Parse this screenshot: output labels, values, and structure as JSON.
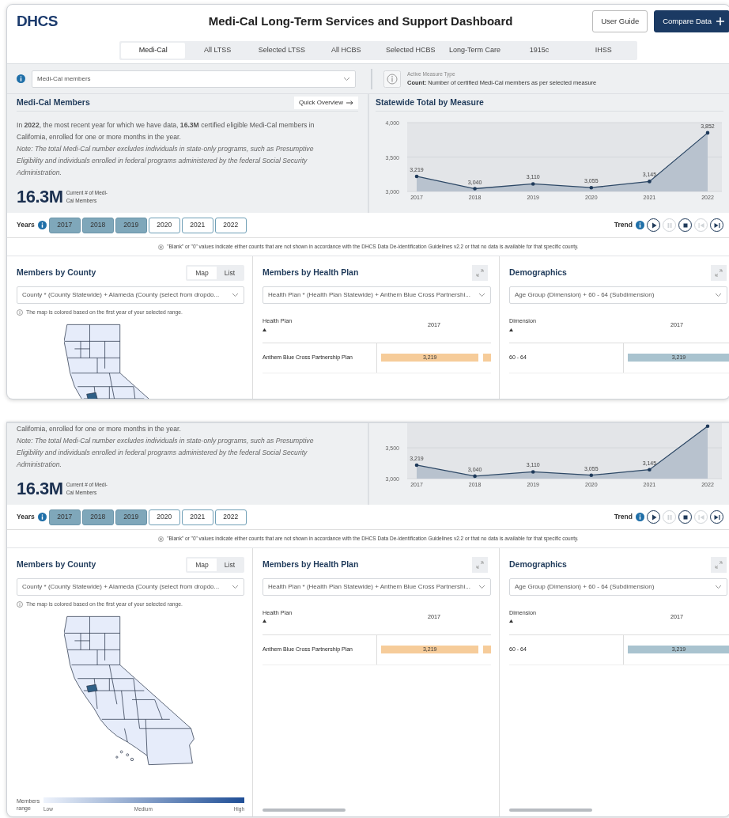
{
  "views": [
    {
      "header": {
        "logo": "DHCS",
        "title": "Medi-Cal Long-Term Services and Support Dashboard",
        "buttons": [
          {
            "label": "User Guide",
            "kind": "outline"
          },
          {
            "label": "Compare Data",
            "kind": "primary"
          }
        ]
      },
      "tabs": [
        {
          "label": "Medi-Cal",
          "selected": true
        },
        {
          "label": "All LTSS",
          "selected": false
        },
        {
          "label": "Selected LTSS",
          "selected": false
        },
        {
          "label": "All HCBS",
          "selected": false
        },
        {
          "label": "Selected HCBS",
          "selected": false
        },
        {
          "label": "Long-Term Care",
          "selected": false
        },
        {
          "label": "1915c",
          "selected": false
        },
        {
          "label": "IHSS",
          "selected": false
        }
      ],
      "measure": {
        "select": "Medi-Cal members",
        "info_label": "Active Measure Type",
        "info_text": "**Count:** Number of certified Medi-Cal members as per selected measure"
      },
      "summary": {
        "title": "Medi-Cal Members",
        "action": "Quick Overview",
        "intro": "In **2022**, the most recent year for which we have data, **16.3M** certified eligible Medi-Cal members in California, enrolled for one or more months in the year.",
        "note": "Note: The total Medi-Cal number excludes individuals in state-only programs, such as Presumptive Eligibility and individuals enrolled in federal programs administered by the federal Social Security Administration.",
        "stat": "16.3M",
        "stat_label": "Current # of Medi-Cal Members"
      },
      "chart": {
        "title": "Statewide Total by Measure",
        "chart_data": {
          "type": "area",
          "categories": [
            "2017",
            "2018",
            "2019",
            "2020",
            "2021",
            "2022"
          ],
          "values": [
            3219,
            3040,
            3110,
            3055,
            3145,
            3852
          ],
          "ylim": [
            3000,
            4000
          ],
          "yticks": [
            {
              "value": 3000,
              "label": "3,000"
            },
            {
              "value": 3500,
              "label": "3,500"
            },
            {
              "value": 4000,
              "label": "4,000"
            }
          ],
          "value_labels": [
            "3,219",
            "3,040",
            "3,110",
            "3,055",
            "3,145",
            "3,852"
          ]
        }
      },
      "years": {
        "label": "Years",
        "items": [
          {
            "label": "2017",
            "selected": true
          },
          {
            "label": "2018",
            "selected": true
          },
          {
            "label": "2019",
            "selected": true
          },
          {
            "label": "2020",
            "selected": false
          },
          {
            "label": "2021",
            "selected": false
          },
          {
            "label": "2022",
            "selected": false
          }
        ]
      },
      "trend": {
        "label": "Trend",
        "controls": [
          {
            "kind": "play",
            "disabled": false
          },
          {
            "kind": "pause",
            "disabled": true
          },
          {
            "kind": "stop",
            "disabled": false
          },
          {
            "kind": "back",
            "disabled": true
          },
          {
            "kind": "end",
            "disabled": false
          }
        ]
      },
      "disclaimer": "\"Blank\" or \"0\" values indicate either counts that are not shown in accordance with the DHCS Data De-identification Guidelines v2.2 or that no data is available for that specific county.",
      "county": {
        "title": "Members by County",
        "toggle": [
          {
            "label": "Map",
            "selected": true
          },
          {
            "label": "List",
            "selected": false
          }
        ],
        "select": "County * (County Statewide) + Alameda (County (select from dropdo...",
        "note": "The map is colored based on the first year of your selected range."
      },
      "health_plan": {
        "title": "Members by Health Plan",
        "select": "Health Plan * (Health Plan Statewide) + Anthem Blue Cross Partnershi...",
        "columns": [
          "Health Plan",
          "2017"
        ],
        "rows": [
          {
            "name": "Anthem Blue Cross Partnership Plan",
            "value": "3,219",
            "level": 0.93
          }
        ]
      },
      "demographics": {
        "title": "Demographics",
        "select": "Age Group (Dimension) + 60 - 64 (Subdimension)",
        "columns": [
          "Dimension",
          "2017"
        ],
        "rows": [
          {
            "name": "60 - 64",
            "value": "3,219",
            "level": 1
          }
        ]
      }
    },
    {
      "summary": {
        "intro": "California, enrolled for one or more months in the year.",
        "note": "Note: The total Medi-Cal number excludes individuals in state-only programs, such as Presumptive Eligibility and individuals enrolled in federal programs administered by the federal Social Security Administration.",
        "stat": "16.3M",
        "stat_label": "Current # of Medi-Cal Members"
      },
      "chart": {
        "chart_data": {
          "type": "area",
          "categories": [
            "2017",
            "2018",
            "2019",
            "2020",
            "2021",
            "2022"
          ],
          "values": [
            3219,
            3040,
            3110,
            3055,
            3145,
            3852
          ],
          "ylim": [
            3000,
            3900
          ],
          "yticks": [
            {
              "value": 3000,
              "label": "3,000"
            },
            {
              "value": 3500,
              "label": "3,500"
            }
          ],
          "value_labels": [
            "3,219",
            "3,040",
            "3,110",
            "3,055",
            "3,145",
            null
          ]
        }
      },
      "years": {
        "label": "Years",
        "items": [
          {
            "label": "2017",
            "selected": true
          },
          {
            "label": "2018",
            "selected": true
          },
          {
            "label": "2019",
            "selected": true
          },
          {
            "label": "2020",
            "selected": false
          },
          {
            "label": "2021",
            "selected": false
          },
          {
            "label": "2022",
            "selected": false
          }
        ]
      },
      "trend": {
        "label": "Trend",
        "controls": [
          {
            "kind": "play",
            "disabled": false
          },
          {
            "kind": "pause",
            "disabled": true
          },
          {
            "kind": "stop",
            "disabled": false
          },
          {
            "kind": "back",
            "disabled": true
          },
          {
            "kind": "end",
            "disabled": false
          }
        ]
      },
      "disclaimer": "\"Blank\" or \"0\" values indicate either counts that are not shown in accordance with the DHCS Data De-identification Guidelines v2.2 or that no data is available for that specific county.",
      "county": {
        "title": "Members by County",
        "toggle": [
          {
            "label": "Map",
            "selected": true
          },
          {
            "label": "List",
            "selected": false
          }
        ],
        "select": "County * (County Statewide) + Alameda (County (select from dropdo...",
        "note": "The map is colored based on the first year of your selected range.",
        "legend": {
          "label": "Members range",
          "low": "Low",
          "medium": "Medium",
          "high": "High"
        }
      },
      "health_plan": {
        "title": "Members by Health Plan",
        "select": "Health Plan * (Health Plan Statewide) + Anthem Blue Cross Partnershi...",
        "columns": [
          "Health Plan",
          "2017"
        ],
        "rows": [
          {
            "name": "Anthem Blue Cross Partnership Plan",
            "value": "3,219",
            "level": 0.93
          }
        ],
        "scrollbar": true
      },
      "demographics": {
        "title": "Demographics",
        "select": "Age Group (Dimension) + 60 - 64 (Subdimension)",
        "columns": [
          "Dimension",
          "2017"
        ],
        "rows": [
          {
            "name": "60 - 64",
            "value": "3,219",
            "level": 1
          }
        ],
        "scrollbar": true
      }
    }
  ]
}
